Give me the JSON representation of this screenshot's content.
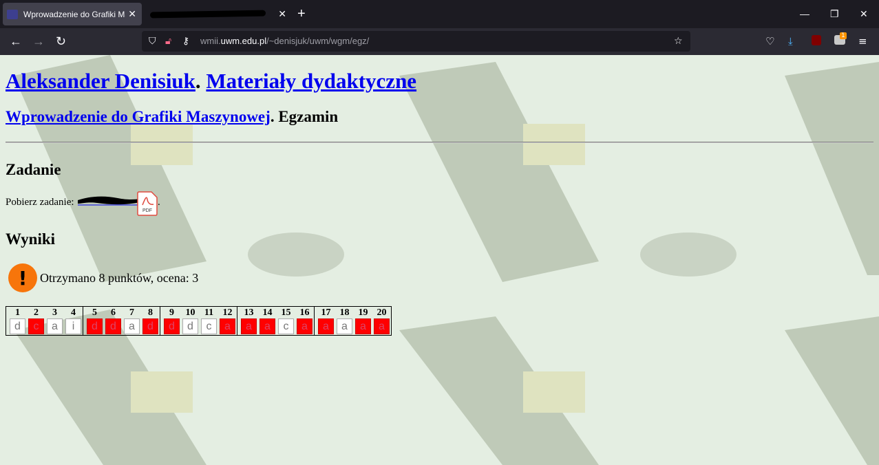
{
  "browser": {
    "active_tab_title": "Wprowadzenie do Grafiki Maszynowej",
    "close_glyph": "✕",
    "new_tab_glyph": "+",
    "window_controls": [
      "—",
      "❐",
      "✕"
    ],
    "url_host": "wmii.uwm.edu.pl",
    "url_path": "/~denisjuk/uwm/wgm/egz/",
    "url_prefix": "wmii.",
    "url_main": "uwm.edu.pl",
    "icons": [
      "back-icon",
      "forward-icon",
      "reload-icon",
      "shield-icon",
      "lock-icon",
      "key-icon",
      "star-icon",
      "pocket-icon",
      "download-icon",
      "ublock-icon",
      "extension-icon",
      "menu-icon"
    ],
    "extension_badge": "1"
  },
  "page": {
    "author_link": "Aleksander Denisiuk",
    "materials_link": "Materiały dydaktyczne",
    "course_link": "Wprowadzenie do Grafiki Maszynowej",
    "exam_label": ". Egzamin",
    "dot": ".",
    "task_heading": "Zadanie",
    "download_label": "Pobierz zadanie:",
    "pdf_label": "PDF",
    "results_heading": "Wyniki",
    "result_text": "Otrzymano 8 punktów, ocena: 3",
    "warn_glyph": "!",
    "answers": [
      {
        "n": "1",
        "a": "d",
        "ok": true
      },
      {
        "n": "2",
        "a": "c",
        "ok": false
      },
      {
        "n": "3",
        "a": "a",
        "ok": true
      },
      {
        "n": "4",
        "a": "i",
        "ok": true
      },
      {
        "n": "5",
        "a": "d",
        "ok": false
      },
      {
        "n": "6",
        "a": "d",
        "ok": false
      },
      {
        "n": "7",
        "a": "a",
        "ok": true
      },
      {
        "n": "8",
        "a": "d",
        "ok": false
      },
      {
        "n": "9",
        "a": "d",
        "ok": false
      },
      {
        "n": "10",
        "a": "d",
        "ok": true
      },
      {
        "n": "11",
        "a": "c",
        "ok": true
      },
      {
        "n": "12",
        "a": "a",
        "ok": false
      },
      {
        "n": "13",
        "a": "a",
        "ok": false
      },
      {
        "n": "14",
        "a": "a",
        "ok": false
      },
      {
        "n": "15",
        "a": "c",
        "ok": true
      },
      {
        "n": "16",
        "a": "a",
        "ok": false
      },
      {
        "n": "17",
        "a": "a",
        "ok": false
      },
      {
        "n": "18",
        "a": "a",
        "ok": true
      },
      {
        "n": "19",
        "a": "a",
        "ok": false
      },
      {
        "n": "20",
        "a": "a",
        "ok": false
      }
    ]
  },
  "colors": {
    "page_bg": "#e4eee2",
    "link": "#0000ee",
    "wrong": "#ff0000",
    "warn": "#f7750b"
  }
}
